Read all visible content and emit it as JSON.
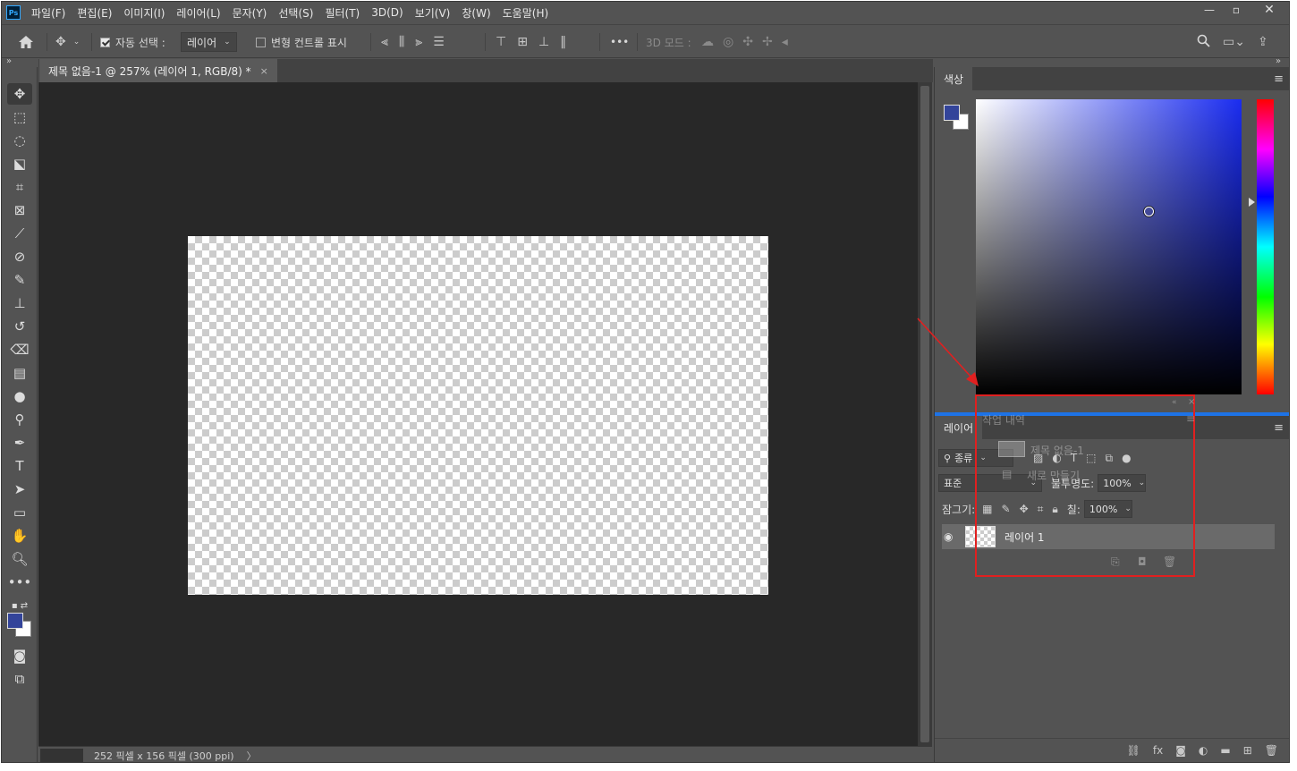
{
  "app": {
    "logo": "Ps",
    "menu": [
      "파일(F)",
      "편집(E)",
      "이미지(I)",
      "레이어(L)",
      "문자(Y)",
      "선택(S)",
      "필터(T)",
      "3D(D)",
      "보기(V)",
      "창(W)",
      "도움말(H)"
    ],
    "window_controls": {
      "minimize": "—",
      "maximize": "▫",
      "close": "✕"
    }
  },
  "options": {
    "auto_select_label": "자동 선택 :",
    "auto_select_checked": true,
    "auto_select_value": "레이어",
    "transform_controls_label": "변형 컨트롤 표시",
    "transform_controls_checked": false,
    "more": "•••",
    "mode_3d_label": "3D 모드 :"
  },
  "document": {
    "tab_title": "제목 없음-1 @ 257% (레이어 1, RGB/8) *",
    "tab_close": "×",
    "status_text": "252 픽셀 x 156 픽셀 (300 ppi)",
    "status_arrow": "〉"
  },
  "colors": {
    "foreground": "#33449a",
    "background": "#ffffff",
    "accent_line": "#1e73e6",
    "highlight_box": "#e02020"
  },
  "color_panel": {
    "title": "색상",
    "menu_icon": "≡"
  },
  "layers_panel": {
    "title": "레이어",
    "menu_icon": "≡",
    "filter_kind": "종류",
    "blend_mode": "표준",
    "opacity_label": "불투명도:",
    "opacity_value": "100%",
    "lock_label": "잠그기:",
    "fill_label": "칠:",
    "fill_value": "100%",
    "layers": [
      {
        "name": "레이어 1",
        "visible": true
      }
    ]
  },
  "history_panel_ghost": {
    "title": "작업 내역",
    "items": [
      "제목 없음-1",
      "새로 만들기"
    ]
  },
  "tools": [
    "move-tool",
    "marquee-tool",
    "lasso-tool",
    "object-select-tool",
    "crop-tool",
    "frame-tool",
    "eyedropper-tool",
    "healing-tool",
    "brush-tool",
    "stamp-tool",
    "history-brush-tool",
    "eraser-tool",
    "gradient-tool",
    "blur-tool",
    "dodge-tool",
    "pen-tool",
    "type-tool",
    "path-select-tool",
    "rectangle-tool",
    "hand-tool",
    "zoom-tool",
    "more-tools"
  ]
}
